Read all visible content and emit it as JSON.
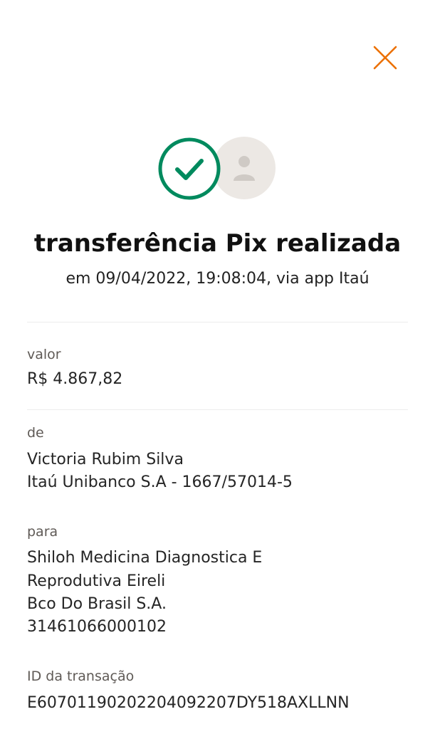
{
  "icons": {
    "close": "close-icon",
    "success": "check-circle-icon",
    "recipient_avatar": "person-avatar-icon"
  },
  "colors": {
    "close_icon": "#ec7000",
    "success_green": "#008a5e",
    "avatar_bg": "#ece8e4",
    "avatar_fg": "#cfcac5"
  },
  "receipt": {
    "title": "transferência Pix realizada",
    "subtitle": "em 09/04/2022, 19:08:04, via app Itaú"
  },
  "fields": {
    "valor": {
      "label": "valor",
      "amount": "R$ 4.867,82"
    },
    "de": {
      "label": "de",
      "name": "Victoria Rubim Silva",
      "bank": "Itaú Unibanco S.A - 1667/57014-5"
    },
    "para": {
      "label": "para",
      "name_line1": "Shiloh Medicina Diagnostica E",
      "name_line2": "Reprodutiva Eireli",
      "bank": "Bco Do Brasil S.A.",
      "document": "31461066000102"
    },
    "id": {
      "label": "ID da transação",
      "value": "E60701190202204092207DY518AXLLNN"
    }
  }
}
